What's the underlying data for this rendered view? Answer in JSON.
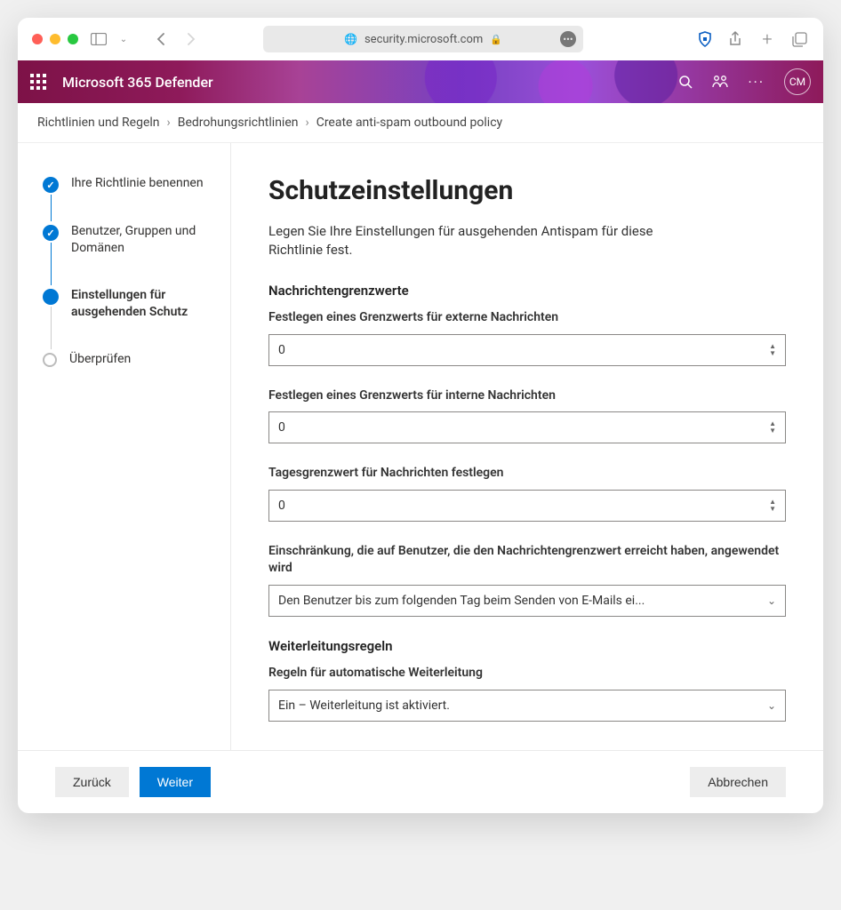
{
  "browser": {
    "url": "security.microsoft.com"
  },
  "header": {
    "app_title": "Microsoft 365 Defender",
    "avatar_initials": "CM"
  },
  "breadcrumb": {
    "items": [
      "Richtlinien und Regeln",
      "Bedrohungsrichtlinien",
      "Create anti-spam outbound policy"
    ]
  },
  "stepper": {
    "steps": [
      {
        "label": "Ihre Richtlinie benennen",
        "state": "done"
      },
      {
        "label": "Benutzer, Gruppen und Domänen",
        "state": "done"
      },
      {
        "label": "Einstellungen für ausgehenden Schutz",
        "state": "current"
      },
      {
        "label": "Überprüfen",
        "state": "pending"
      }
    ]
  },
  "main": {
    "title": "Schutzeinstellungen",
    "subtitle": "Legen Sie Ihre Einstellungen für ausgehenden Antispam für diese Richtlinie fest.",
    "section_limits_title": "Nachrichtengrenzwerte",
    "external_limit_label": "Festlegen eines Grenzwerts für externe Nachrichten",
    "external_limit_value": "0",
    "internal_limit_label": "Festlegen eines Grenzwerts für interne Nachrichten",
    "internal_limit_value": "0",
    "daily_limit_label": "Tagesgrenzwert für Nachrichten festlegen",
    "daily_limit_value": "0",
    "restriction_label": "Einschränkung, die auf Benutzer, die den Nachrichtengrenzwert erreicht haben, angewendet wird",
    "restriction_value": "Den Benutzer bis zum folgenden Tag beim Senden von E-Mails ei...",
    "section_forward_title": "Weiterleitungsregeln",
    "forward_rules_label": "Regeln für automatische Weiterleitung",
    "forward_rules_value": "Ein – Weiterleitung ist aktiviert."
  },
  "footer": {
    "back": "Zurück",
    "next": "Weiter",
    "cancel": "Abbrechen"
  }
}
